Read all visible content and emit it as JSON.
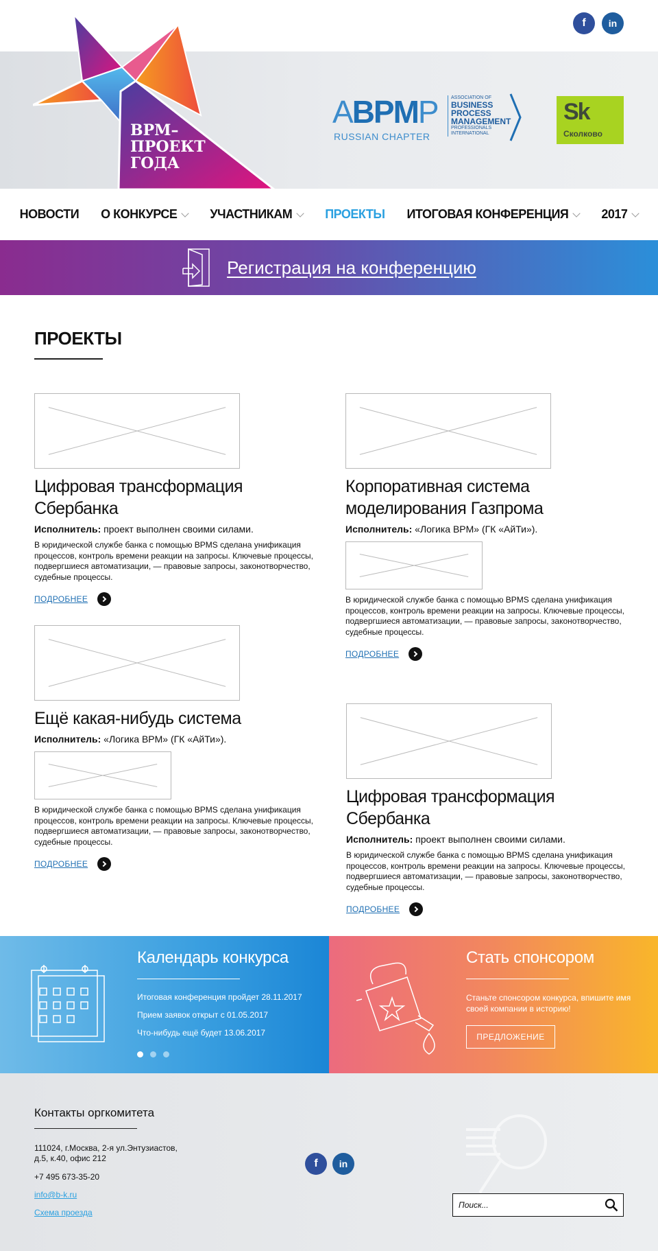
{
  "header": {
    "logo_lines": [
      "BPM–",
      "ПРОЕКТ",
      "ГОДА"
    ],
    "social": [
      {
        "icon": "facebook-icon",
        "glyph": "f"
      },
      {
        "icon": "linkedin-icon",
        "glyph": "in"
      }
    ],
    "abpmp": {
      "big_a": "A",
      "big_bpm": "BPM",
      "big_p": "P",
      "sub": "RUSSIAN CHAPTER",
      "assoc": "ASSOCIATION OF",
      "name1": "BUSINESS",
      "name2": "PROCESS",
      "name3": "MANAGEMENT",
      "prof": "PROFESSIONALS",
      "intl": "INTERNATIONAL"
    },
    "skolkovo": {
      "big": "Sk",
      "small": "Сколково"
    }
  },
  "nav": {
    "items": [
      "НОВОСТИ",
      "О КОНКУРСЕ",
      "УЧАСТНИКАМ",
      "ПРОЕКТЫ",
      "ИТОГОВАЯ КОНФЕРЕНЦИЯ",
      "2017"
    ],
    "active": "ПРОЕКТЫ"
  },
  "registration": {
    "label": "Регистрация на конференцию"
  },
  "main": {
    "title": "ПРОЕКТЫ",
    "projects": [
      {
        "title": "Цифровая трансформация Сбербанка",
        "exec_label": "Исполнитель:",
        "exec_value": " проект выполнен своими силами.",
        "desc": "В юридической службе банка с помощью BPMS сделана унификация процессов, контроль времени реакции на запросы. Ключевые процессы, подвергшиеся автоматизации, — правовые запросы, законотворчество, судебные процессы.",
        "more": "ПОДРОБНЕЕ"
      },
      {
        "title": "Корпоративная система моделирования Газпрома",
        "exec_label": "Исполнитель:",
        "exec_value": " «Логика BPM» (ГК «АйТи»).",
        "desc": "В юридической службе банка с помощью BPMS сделана унификация процессов, контроль времени реакции на запросы. Ключевые процессы, подвергшиеся автоматизации, — правовые запросы, законотворчество, судебные процессы.",
        "more": "ПОДРОБНЕЕ"
      },
      {
        "title": "Ещё какая-нибудь система",
        "exec_label": "Исполнитель:",
        "exec_value": " «Логика BPM» (ГК «АйТи»).",
        "desc": "В юридической службе банка с помощью BPMS сделана унификация процессов, контроль времени реакции на запросы. Ключевые процессы, подвергшиеся автоматизации, — правовые запросы, законотворчество, судебные процессы.",
        "more": "ПОДРОБНЕЕ"
      },
      {
        "title": "Цифровая трансформация Сбербанка",
        "exec_label": "Исполнитель:",
        "exec_value": " проект выполнен своими силами.",
        "desc": "В юридической службе банка с помощью BPMS сделана унификация процессов, контроль времени реакции на запросы. Ключевые процессы, подвергшиеся автоматизации, — правовые запросы, законотворчество, судебные процессы.",
        "more": "ПОДРОБНЕЕ"
      }
    ]
  },
  "calendar": {
    "title": "Календарь конкурса",
    "lines": [
      "Итоговая конференция пройдет 28.11.2017",
      "Прием заявок открыт с 01.05.2017",
      "Что-нибудь ещё будет 13.06.2017"
    ],
    "slides": 3,
    "active_slide": 1
  },
  "sponsor": {
    "title": "Стать спонсором",
    "text": "Станьте спонсором конкурса, впишите имя своей компании в историю!",
    "button": "ПРЕДЛОЖЕНИЕ"
  },
  "footer": {
    "title": "Контакты оргкомитета",
    "address1": "111024, г.Москва, 2-я ул.Энтузиастов,",
    "address2": "д.5, к.40, офис 212",
    "phone": "+7 495 673-35-20",
    "email": "info@b-k.ru",
    "map": "Схема проезда",
    "search_placeholder": "Поиск..."
  },
  "colors": {
    "accent": "#2aa0e0",
    "reg_gradient_start": "#8a2c8f",
    "reg_gradient_end": "#2b8fd9",
    "calendar": "#3a9fe0",
    "sponsor_start": "#ec6b7e",
    "sponsor_end": "#f9b62a",
    "skolkovo": "#a8d321"
  }
}
